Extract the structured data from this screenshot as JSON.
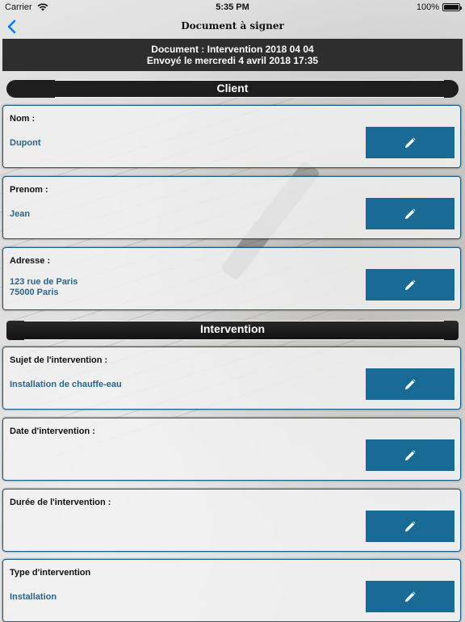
{
  "status_bar": {
    "carrier": "Carrier",
    "time": "5:35 PM",
    "battery_percent": "100%",
    "battery_level": 1.0
  },
  "nav": {
    "title": "Document à signer",
    "back_icon": "chevron-left-icon"
  },
  "document": {
    "line1": "Document : Intervention 2018 04 04",
    "line2": "Envoyé le mercredi 4 avril 2018 17:35"
  },
  "sections": {
    "client": "Client",
    "intervention": "Intervention"
  },
  "fields": {
    "nom": {
      "label": "Nom :",
      "value": "Dupont"
    },
    "prenom": {
      "label": "Prenom :",
      "value": "Jean"
    },
    "adresse": {
      "label": "Adresse :",
      "value": "123 rue de Paris\n75000 Paris"
    },
    "sujet": {
      "label": "Sujet de l'intervention :",
      "value": "Installation de chauffe-eau"
    },
    "date": {
      "label": "Date d'intervention :",
      "value": ""
    },
    "duree": {
      "label": "Durée de l'intervention :",
      "value": ""
    },
    "type": {
      "label": "Type d'intervention",
      "value": "Installation"
    }
  },
  "colors": {
    "accent": "#1a6a96",
    "value_text": "#2b6689",
    "ios_blue": "#007aff",
    "header_bg": "#2e2e2e"
  },
  "icons": {
    "edit": "pencil-icon",
    "wifi": "wifi-icon",
    "battery": "battery-icon"
  }
}
